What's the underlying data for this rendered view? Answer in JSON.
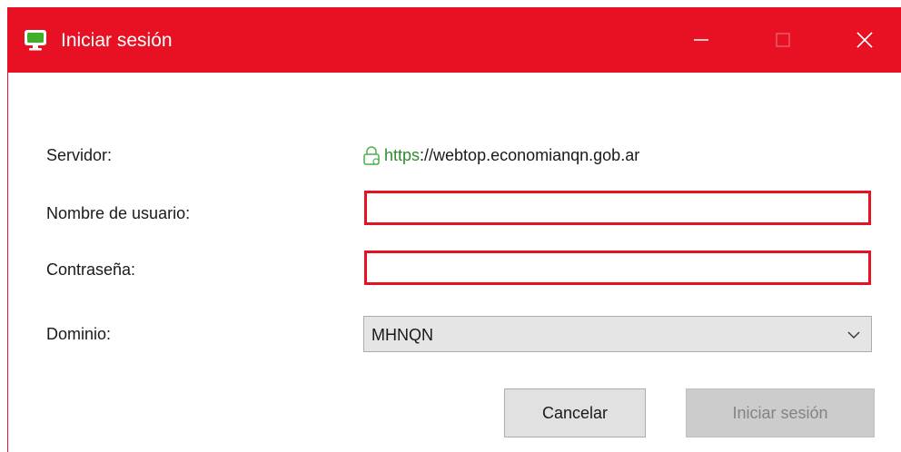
{
  "window": {
    "title": "Iniciar sesión",
    "controls": {
      "minimize_icon": "minimize-icon",
      "maximize_icon": "maximize-icon",
      "close_icon": "close-icon"
    },
    "accent_color": "#e81123"
  },
  "form": {
    "server_label": "Servidor:",
    "server_url_scheme": "https",
    "server_url_rest": "://webtop.economianqn.gob.ar",
    "username_label": "Nombre de usuario:",
    "username_value": "",
    "password_label": "Contraseña:",
    "password_value": "",
    "domain_label": "Dominio:",
    "domain_selected": "MHNQN"
  },
  "buttons": {
    "cancel_label": "Cancelar",
    "login_label": "Iniciar sesión"
  },
  "icons": {
    "app": "monitor-icon",
    "lock": "lock-icon",
    "dropdown": "chevron-down-icon"
  }
}
